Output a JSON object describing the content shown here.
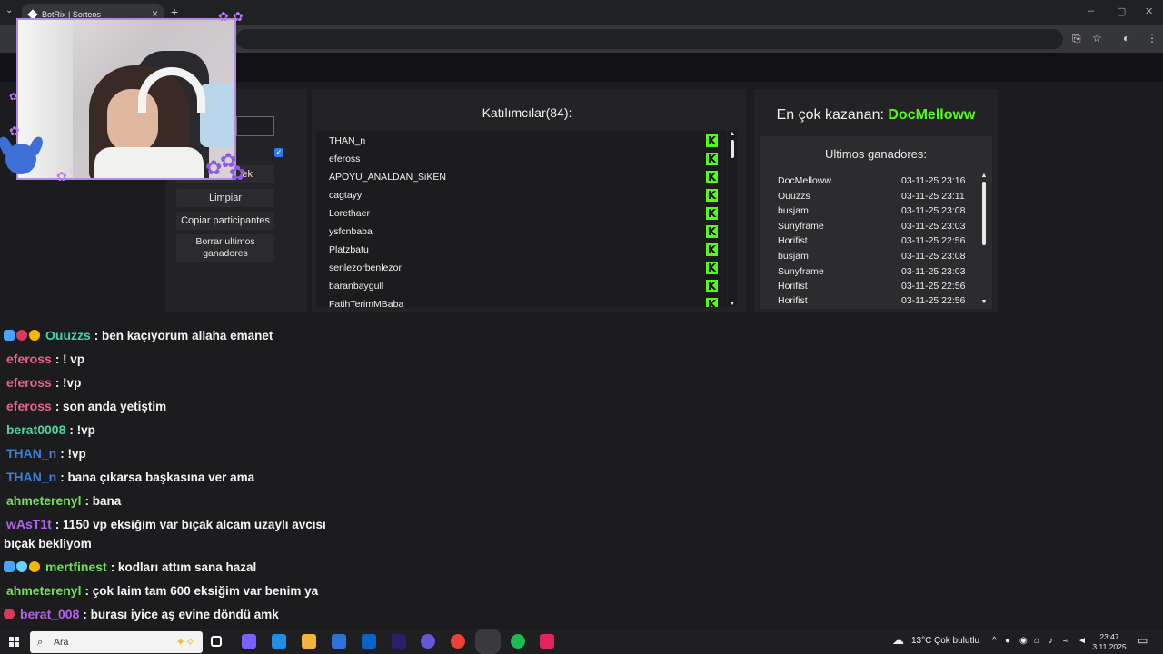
{
  "browser": {
    "tab_title": "BotRix | Sorteos",
    "tab_close": "×",
    "new_tab": "+",
    "tab_menu": "⌄",
    "window_controls": [
      "–",
      "▢",
      "✕"
    ]
  },
  "left_panel": {
    "buttons": {
      "partial_label": "ek",
      "clear": "Limpiar",
      "copy_participants": "Copiar participantes",
      "delete_winners": "Borrar ultimos ganadores"
    },
    "checkbox_checked": true
  },
  "participants": {
    "title": "Katılımcılar(84):",
    "platform_badge": "K",
    "list": [
      "THAN_n",
      "efeross",
      "APOYU_ANALDAN_SiKEN",
      "cagtayy",
      "Lorethaer",
      "ysfcnbaba",
      "Platzbatu",
      "senlezorbenlezor",
      "baranbaygull",
      "FatihTerimMBaba"
    ]
  },
  "winners": {
    "top_label": "En çok kazanan:",
    "top_winner": "DocMelloww",
    "recent_title": "Ultimos ganadores:",
    "recent": [
      {
        "name": "DocMelloww",
        "date": "03-11-25 23:16"
      },
      {
        "name": "Ouuzzs",
        "date": "03-11-25 23:11"
      },
      {
        "name": "busjam",
        "date": "03-11-25 23:08"
      },
      {
        "name": "Sunyframe",
        "date": "03-11-25 23:03"
      },
      {
        "name": "Horifist",
        "date": "03-11-25 22:56"
      },
      {
        "name": "busjam",
        "date": "03-11-25 23:08"
      },
      {
        "name": "Sunyframe",
        "date": "03-11-25 23:03"
      },
      {
        "name": "Horifist",
        "date": "03-11-25 22:56"
      },
      {
        "name": "Horifist",
        "date": "03-11-25 22:56"
      }
    ]
  },
  "chat": [
    {
      "badges": [
        "cube",
        "devil",
        "coin"
      ],
      "user": "Ouuzzs",
      "color": "#3ed6a8",
      "text": ": ben kaçıyorum allaha emanet"
    },
    {
      "badges": [],
      "user": "efeross",
      "color": "#e8628a",
      "text": ": ! vp"
    },
    {
      "badges": [],
      "user": "efeross",
      "color": "#e8628a",
      "text": ": !vp"
    },
    {
      "badges": [],
      "user": "efeross",
      "color": "#e8628a",
      "text": ": son anda yetiştim"
    },
    {
      "badges": [],
      "user": "berat0008",
      "color": "#4fd6a0",
      "text": ": !vp"
    },
    {
      "badges": [],
      "user": "THAN_n",
      "color": "#3b7fd8",
      "text": ": !vp"
    },
    {
      "badges": [],
      "user": "THAN_n",
      "color": "#3b7fd8",
      "text": ": bana çıkarsa başkasına ver ama"
    },
    {
      "badges": [],
      "user": "ahmeterenyl",
      "color": "#72e05a",
      "text": ": bana"
    },
    {
      "badges": [],
      "user": "wAsT1t",
      "color": "#b264e6",
      "text": ": 1150 vp eksiğim var bıçak alcam uzaylı avcısı"
    },
    {
      "badges": [],
      "user": "",
      "color": "#f4f4f4",
      "text": "bıçak bekliyom"
    },
    {
      "badges": [
        "cube",
        "shield",
        "coin"
      ],
      "user": "mertfinest",
      "color": "#72e05a",
      "text": ": kodları attım sana hazal"
    },
    {
      "badges": [],
      "user": "ahmeterenyl",
      "color": "#72e05a",
      "text": ": çok laim tam 600 eksiğim var benim ya"
    },
    {
      "badges": [
        "devil"
      ],
      "user": "berat_008",
      "color": "#b264e6",
      "text": ": burası iyice aş evine döndü amk"
    }
  ],
  "taskbar": {
    "search_placeholder": "Ara",
    "weather_temp": "13°C",
    "weather_desc": "Çok bulutlu",
    "time": "23:47",
    "date": "3.11.2025",
    "app_colors": [
      "#ffffff",
      "#7b61ff",
      "#1f8fe5",
      "#f0b53a",
      "#2d72d6",
      "#0a64c8",
      "#2a1f6b",
      "#6458d8",
      "#ea4335",
      "#3a3a3f",
      "#1db954",
      "#e0245e"
    ]
  },
  "colors": {
    "kick_green": "#53fc18",
    "webcam_border": "#b08be8"
  }
}
